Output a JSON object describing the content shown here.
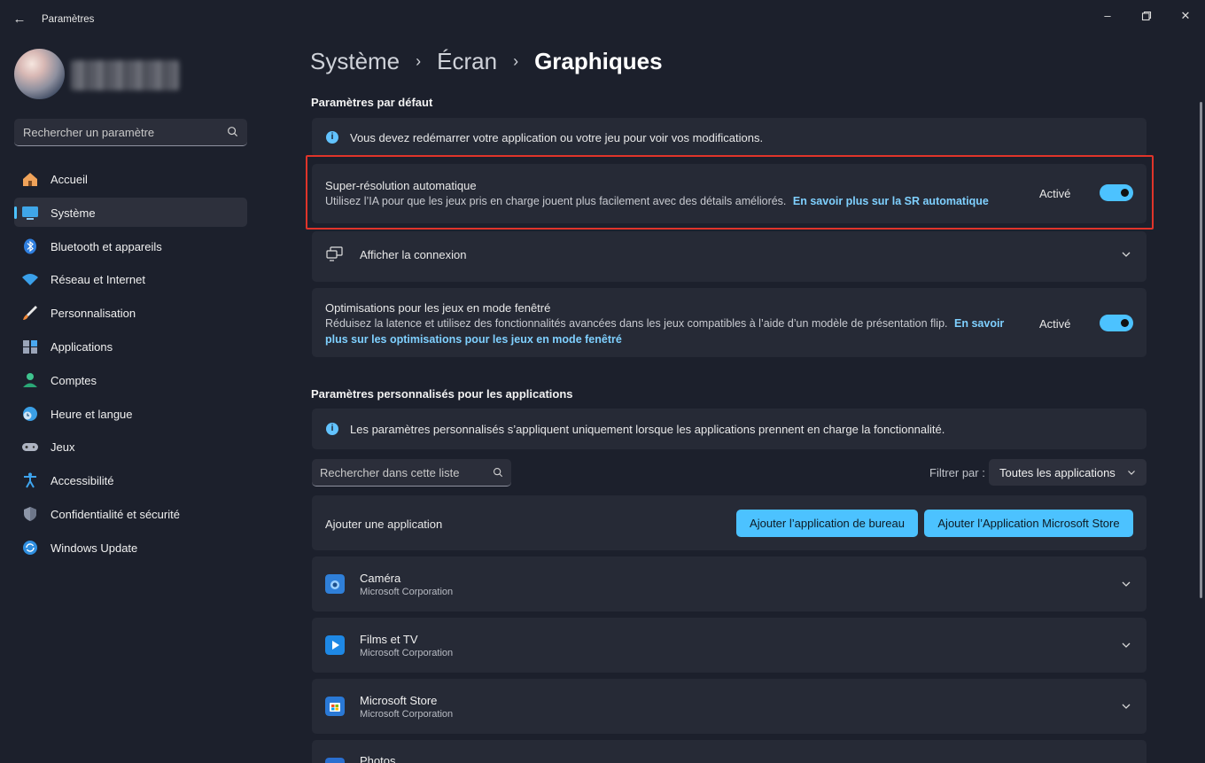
{
  "window": {
    "title": "Paramètres",
    "controls": [
      "minimize",
      "restore",
      "close"
    ]
  },
  "sidebar": {
    "search_placeholder": "Rechercher un paramètre",
    "items": [
      {
        "label": "Accueil",
        "icon": "home-icon",
        "active": false
      },
      {
        "label": "Système",
        "icon": "monitor-icon",
        "active": true
      },
      {
        "label": "Bluetooth et appareils",
        "icon": "bluetooth-icon",
        "active": false
      },
      {
        "label": "Réseau et Internet",
        "icon": "wifi-icon",
        "active": false
      },
      {
        "label": "Personnalisation",
        "icon": "brush-icon",
        "active": false
      },
      {
        "label": "Applications",
        "icon": "apps-icon",
        "active": false
      },
      {
        "label": "Comptes",
        "icon": "person-icon",
        "active": false
      },
      {
        "label": "Heure et langue",
        "icon": "clock-globe-icon",
        "active": false
      },
      {
        "label": "Jeux",
        "icon": "gamepad-icon",
        "active": false
      },
      {
        "label": "Accessibilité",
        "icon": "accessibility-icon",
        "active": false
      },
      {
        "label": "Confidentialité et sécurité",
        "icon": "shield-icon",
        "active": false
      },
      {
        "label": "Windows Update",
        "icon": "update-icon",
        "active": false
      }
    ]
  },
  "breadcrumb": {
    "parts": [
      "Système",
      "Écran"
    ],
    "current": "Graphiques"
  },
  "default_settings": {
    "title": "Paramètres par défaut",
    "info": "Vous devez redémarrer votre application ou votre jeu pour voir vos modifications.",
    "auto_sr": {
      "title": "Super-résolution automatique",
      "desc": "Utilisez l’IA pour que les jeux pris en charge jouent plus facilement avec des détails améliorés.",
      "link": "En savoir plus sur la SR automatique",
      "status": "Activé",
      "on": true
    },
    "display_connection": {
      "label": "Afficher la connexion"
    },
    "windowed_opt": {
      "title": "Optimisations pour les jeux en mode fenêtré",
      "desc": "Réduisez la latence et utilisez des fonctionnalités avancées dans les jeux compatibles à l’aide d’un modèle de présentation flip.",
      "link_a": "En",
      "link_b": "savoir plus sur les optimisations pour les jeux en mode fenêtré",
      "status": "Activé",
      "on": true
    }
  },
  "custom_settings": {
    "title": "Paramètres personnalisés pour les applications",
    "info": "Les paramètres personnalisés s’appliquent uniquement lorsque les applications prennent en charge la fonctionnalité.",
    "search_placeholder": "Rechercher dans cette liste",
    "filter_label": "Filtrer par :",
    "filter_value": "Toutes les applications",
    "add_app_label": "Ajouter une application",
    "add_desktop_button": "Ajouter l’application de bureau",
    "add_store_button": "Ajouter l’Application Microsoft Store",
    "apps": [
      {
        "name": "Caméra",
        "publisher": "Microsoft Corporation",
        "icon": "camera-app-icon"
      },
      {
        "name": "Films et TV",
        "publisher": "Microsoft Corporation",
        "icon": "films-tv-app-icon"
      },
      {
        "name": "Microsoft Store",
        "publisher": "Microsoft Corporation",
        "icon": "store-app-icon"
      },
      {
        "name": "Photos",
        "publisher": "",
        "icon": "photos-app-icon"
      }
    ]
  },
  "colors": {
    "accent": "#4cc2ff",
    "highlight_border": "#e0342a",
    "background": "#1c202c",
    "card": "#262a36"
  }
}
